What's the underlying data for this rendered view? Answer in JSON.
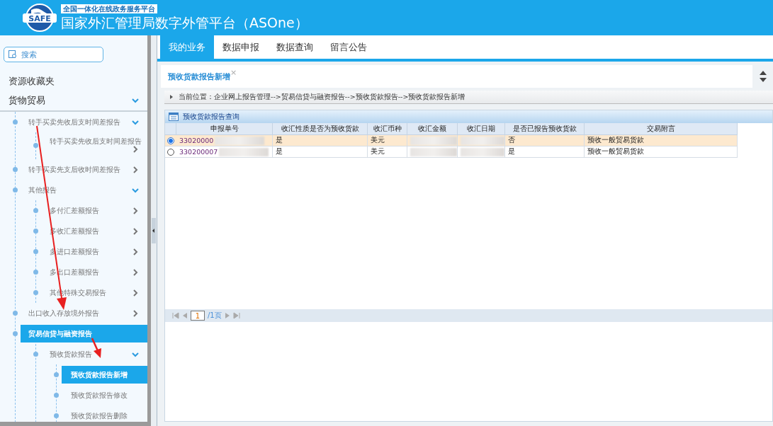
{
  "header": {
    "subtitle": "全国一体化在线政务服务平台",
    "title": "国家外汇管理局数字外管平台（ASOne）",
    "logo_text": "SAFE"
  },
  "sidebar": {
    "search": {
      "placeholder": "搜索"
    },
    "sections": [
      {
        "label": "资源收藏夹"
      },
      {
        "label": "货物贸易",
        "expanded": true
      }
    ],
    "tree": [
      {
        "label": "转手买卖先收后支时间差报告",
        "expanded": true,
        "selected": false,
        "children": [
          {
            "label": "转手买卖先收后支时间差报告",
            "expanded": false,
            "selected": false
          }
        ]
      },
      {
        "label": "转手买卖先支后收时间差报告",
        "expanded": false,
        "selected": false
      },
      {
        "label": "其他报告",
        "expanded": true,
        "selected": false,
        "children": [
          {
            "label": "多付汇差额报告",
            "expanded": false,
            "selected": false
          },
          {
            "label": "多收汇差额报告",
            "expanded": false,
            "selected": false
          },
          {
            "label": "多进口差额报告",
            "expanded": false,
            "selected": false
          },
          {
            "label": "多出口差额报告",
            "expanded": false,
            "selected": false
          },
          {
            "label": "其他特殊交易报告",
            "expanded": false,
            "selected": false
          }
        ]
      },
      {
        "label": "出口收入存放境外报告",
        "expanded": false,
        "selected": false
      },
      {
        "label": "贸易信贷与融资报告",
        "selected": true,
        "children": [
          {
            "label": "预收货款报告",
            "expanded": true,
            "selected": false,
            "children": [
              {
                "label": "预收货款报告新增",
                "selected": true
              },
              {
                "label": "预收货款报告修改",
                "selected": false
              },
              {
                "label": "预收货款报告删除",
                "selected": false
              }
            ]
          }
        ]
      }
    ]
  },
  "tabs": [
    {
      "label": "我的业务",
      "selected": true
    },
    {
      "label": "数据申报",
      "selected": false
    },
    {
      "label": "数据查询",
      "selected": false
    },
    {
      "label": "留言公告",
      "selected": false
    }
  ],
  "page_tab": {
    "label": "预收货款报告新增",
    "close": "×"
  },
  "breadcrumb": "当前位置：企业网上报告管理-->贸易信贷与融资报告-->预收货款报告-->预收货款报告新增",
  "panel": {
    "title": "预收货款报告查询",
    "columns": [
      "申报单号",
      "收汇性质是否为预收货款",
      "收汇币种",
      "收汇金额",
      "收汇日期",
      "是否已报告预收货款",
      "交易附言"
    ],
    "rows": [
      {
        "selected": true,
        "cells": [
          {
            "text": "33020000",
            "blurred": true
          },
          {
            "text": "是"
          },
          {
            "text": "美元"
          },
          {
            "blurred": true
          },
          {
            "blurred": true
          },
          {
            "text": "否"
          },
          {
            "text": "预收一般贸易货款"
          }
        ]
      },
      {
        "selected": false,
        "cells": [
          {
            "text": "330200007",
            "blurred": true
          },
          {
            "text": "是"
          },
          {
            "text": "美元"
          },
          {
            "blurred": true
          },
          {
            "blurred": true
          },
          {
            "text": "是"
          },
          {
            "text": "预收一般贸易货款"
          }
        ]
      }
    ],
    "pager": {
      "page": "1",
      "total": "/1页"
    }
  }
}
